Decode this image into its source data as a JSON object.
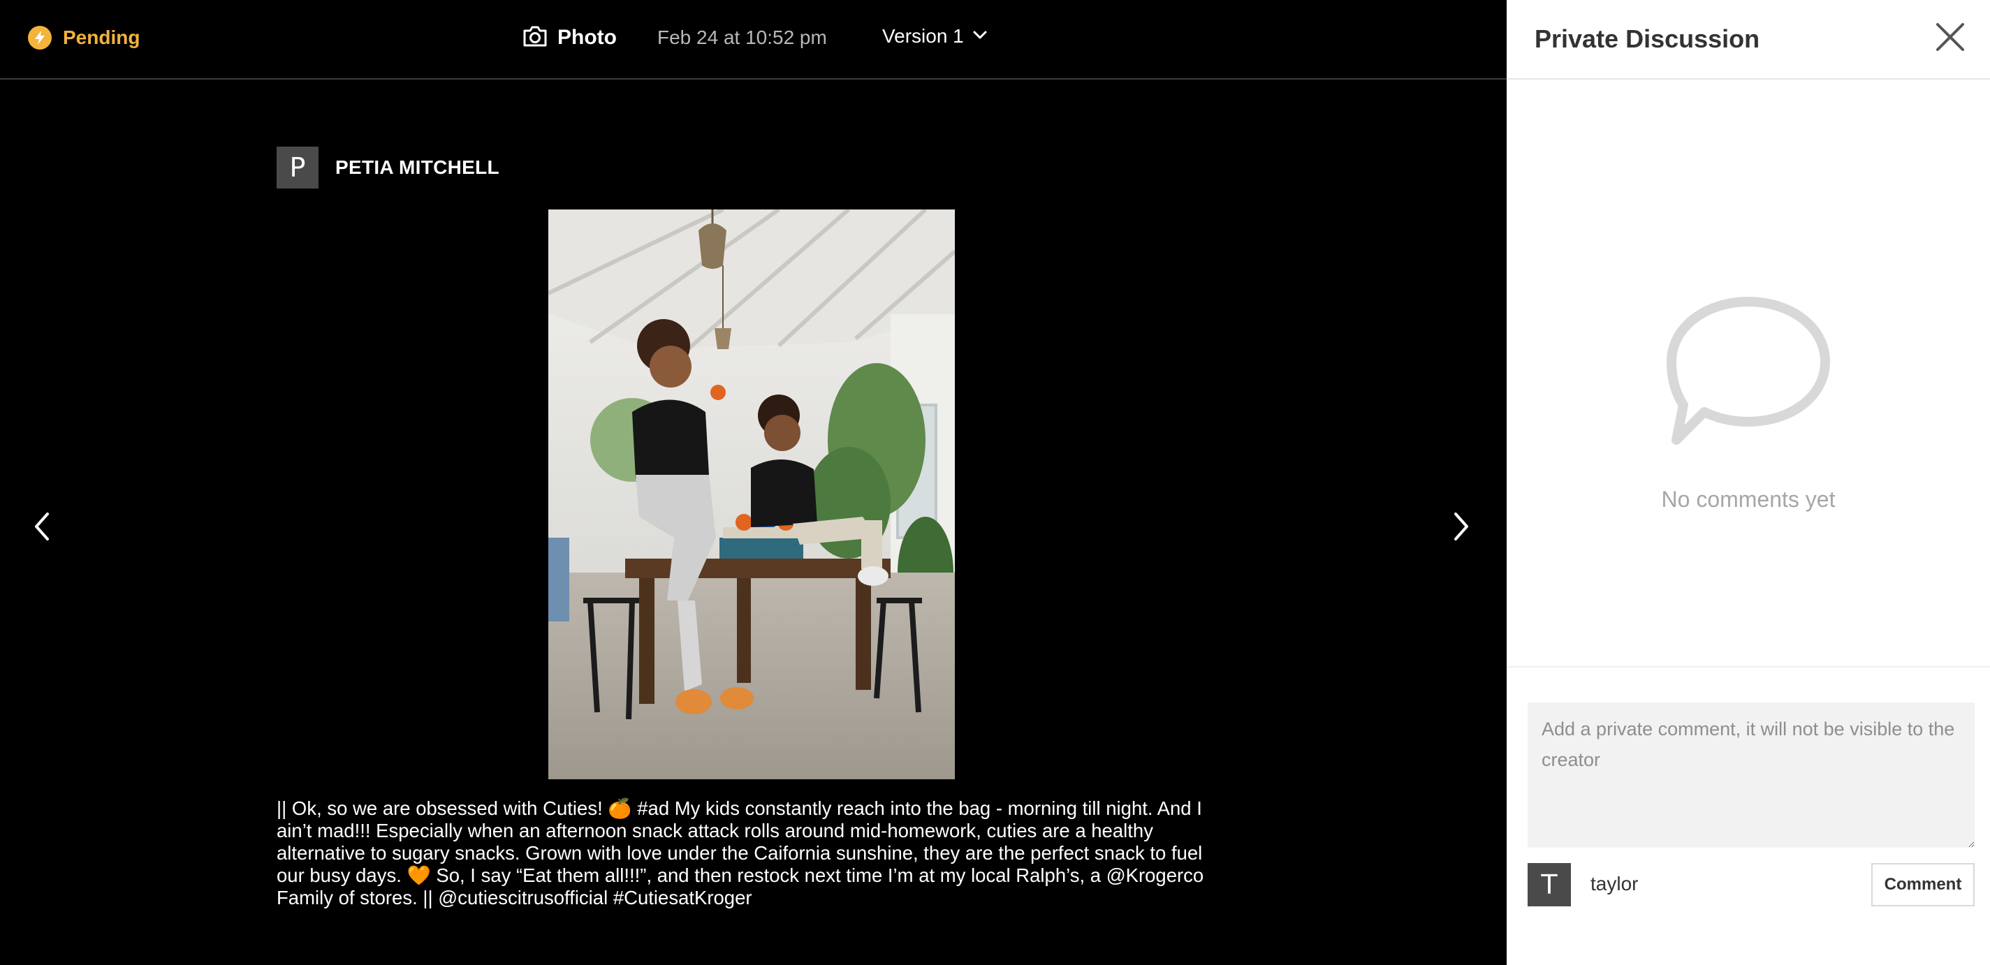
{
  "topbar": {
    "status": {
      "label": "Pending",
      "icon": "lightning-bolt-icon",
      "color": "#f3b33d"
    },
    "media_type": {
      "label": "Photo",
      "icon": "camera-icon"
    },
    "timestamp": "Feb 24 at 10:52 pm",
    "version": {
      "label": "Version 1",
      "icon": "chevron-down-icon"
    }
  },
  "post": {
    "author": {
      "initial": "P",
      "name": "PETIA MITCHELL"
    },
    "photo_alt": "Two kids sitting at a wooden table on a covered patio holding a bag of Cuties",
    "caption": "|| Ok, so we are obsessed with Cuties! 🍊  #ad My kids constantly reach into the bag - morning till night. And I ain’t mad!!! Especially when an afternoon snack attack rolls around mid-homework, cuties are a healthy alternative to sugary snacks. Grown with love under the Caifornia sunshine, they are the perfect snack to fuel our busy days. 🧡  So, I say “Eat them all!!!”, and then restock next time I’m at my local Ralph’s, a @Krogerco Family of stores. || @cutiescitrusofficial #CutiesatKroger"
  },
  "navigation": {
    "prev_icon": "chevron-left-icon",
    "next_icon": "chevron-right-icon"
  },
  "panel": {
    "title": "Private Discussion",
    "close_icon": "close-icon",
    "empty_icon": "speech-bubble-icon",
    "empty_text": "No comments yet",
    "composer": {
      "placeholder": "Add a private comment, it will not be visible to the creator",
      "value": ""
    },
    "user": {
      "initial": "T",
      "name": "taylor"
    },
    "submit_label": "Comment"
  }
}
